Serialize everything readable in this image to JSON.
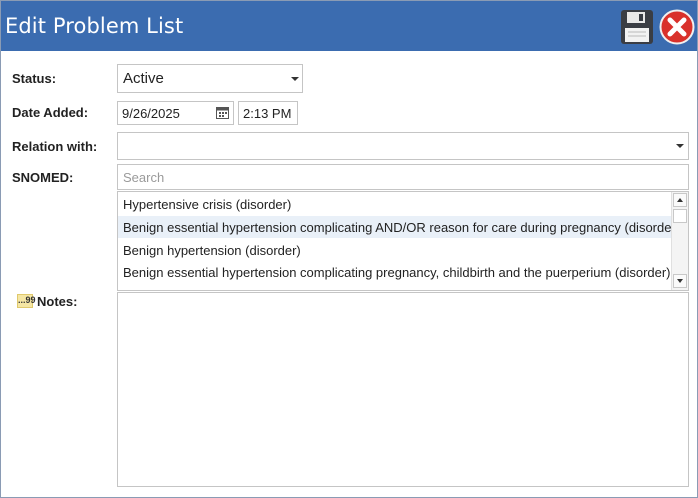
{
  "window": {
    "title": "Edit Problem List"
  },
  "toolbar": {
    "save_icon": "floppy-disk-icon",
    "close_icon": "red-close-x-icon"
  },
  "form": {
    "status": {
      "label": "Status:",
      "value": "Active"
    },
    "date_added": {
      "label": "Date Added:",
      "date": "9/26/2025",
      "time": "2:13 PM"
    },
    "relation_with": {
      "label": "Relation with:",
      "value": ""
    },
    "snomed": {
      "label": "SNOMED:",
      "search_placeholder": "Search",
      "results": [
        {
          "text": "Hypertensive crisis (disorder)",
          "selected": false
        },
        {
          "text": "Benign essential hypertension complicating AND/OR reason for care during pregnancy (disorder)",
          "selected": true
        },
        {
          "text": "Benign hypertension (disorder)",
          "selected": false
        },
        {
          "text": "Benign essential hypertension complicating pregnancy, childbirth and the puerperium (disorder)",
          "selected": false
        }
      ]
    },
    "notes": {
      "label": "Notes:",
      "icon_text": "...99",
      "value": ""
    }
  },
  "colors": {
    "titlebar": "#3b6cb0",
    "selected_row": "#e9f0f8",
    "close": "#d9312b",
    "notes_icon": "#f5e6a4"
  }
}
